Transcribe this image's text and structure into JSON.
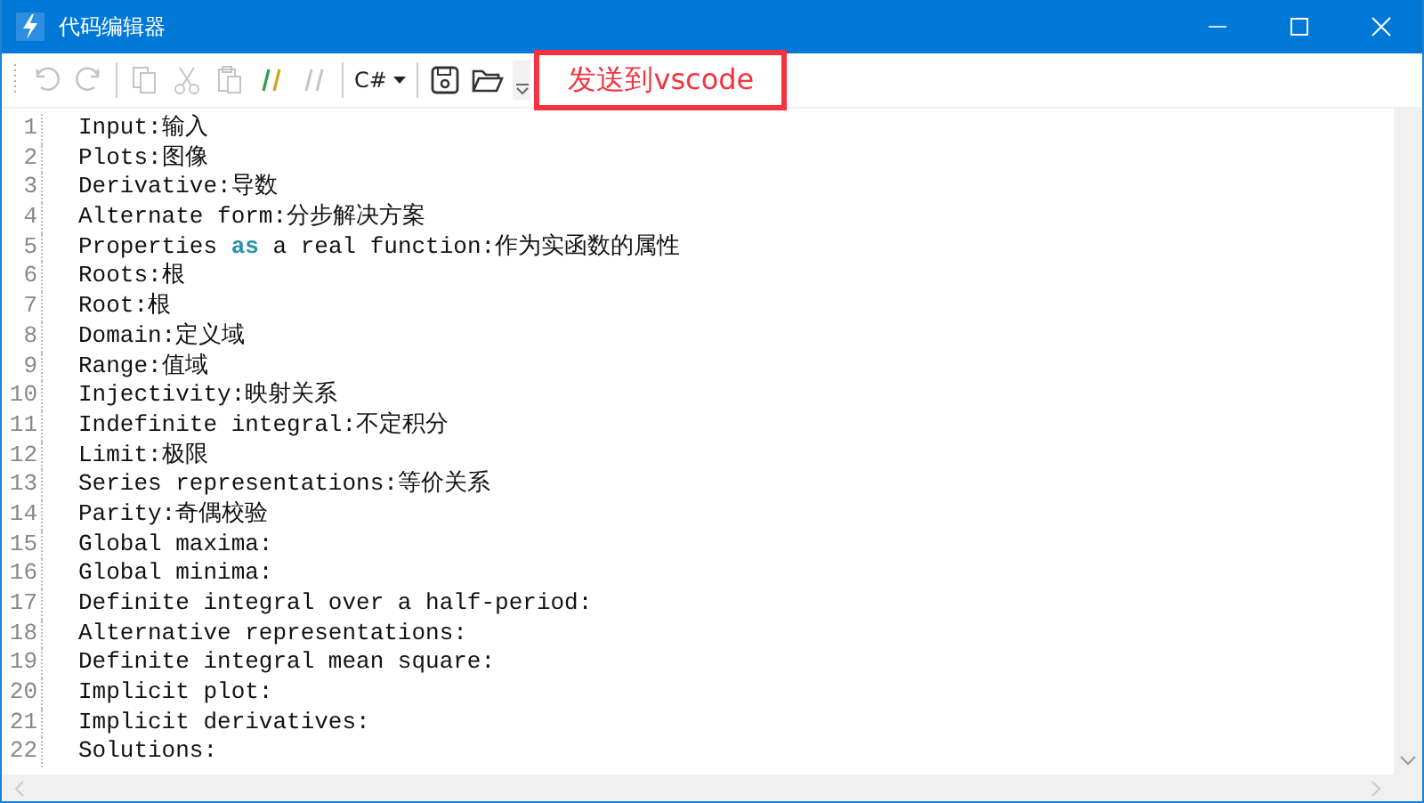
{
  "window": {
    "title": "代码编辑器"
  },
  "toolbar": {
    "tools": [
      {
        "kind": "undo",
        "disabled": true
      },
      {
        "kind": "redo",
        "disabled": true
      },
      {
        "kind": "separator"
      },
      {
        "kind": "copy",
        "disabled": true
      },
      {
        "kind": "cut",
        "disabled": true
      },
      {
        "kind": "paste",
        "disabled": true
      },
      {
        "kind": "comment",
        "disabled": false
      },
      {
        "kind": "uncomment",
        "disabled": true
      },
      {
        "kind": "separator"
      },
      {
        "kind": "language",
        "label": "C#"
      },
      {
        "kind": "separator"
      },
      {
        "kind": "save",
        "disabled": false
      },
      {
        "kind": "open",
        "disabled": false
      },
      {
        "kind": "overflow"
      }
    ],
    "send_button": {
      "label": "发送到vscode"
    }
  },
  "editor": {
    "lines": [
      {
        "number": "1",
        "segments": [
          {
            "kind": "plain",
            "text": "Input:输入"
          }
        ]
      },
      {
        "number": "2",
        "segments": [
          {
            "kind": "plain",
            "text": "Plots:图像"
          }
        ]
      },
      {
        "number": "3",
        "segments": [
          {
            "kind": "plain",
            "text": "Derivative:导数"
          }
        ]
      },
      {
        "number": "4",
        "segments": [
          {
            "kind": "plain",
            "text": "Alternate form:分步解决方案"
          }
        ]
      },
      {
        "number": "5",
        "segments": [
          {
            "kind": "plain",
            "text": "Properties "
          },
          {
            "kind": "keyword",
            "text": "as"
          },
          {
            "kind": "plain",
            "text": " a real function:作为实函数的属性"
          }
        ]
      },
      {
        "number": "6",
        "segments": [
          {
            "kind": "plain",
            "text": "Roots:根"
          }
        ]
      },
      {
        "number": "7",
        "segments": [
          {
            "kind": "plain",
            "text": "Root:根"
          }
        ]
      },
      {
        "number": "8",
        "segments": [
          {
            "kind": "plain",
            "text": "Domain:定义域"
          }
        ]
      },
      {
        "number": "9",
        "segments": [
          {
            "kind": "plain",
            "text": "Range:值域"
          }
        ]
      },
      {
        "number": "10",
        "segments": [
          {
            "kind": "plain",
            "text": "Injectivity:映射关系"
          }
        ]
      },
      {
        "number": "11",
        "segments": [
          {
            "kind": "plain",
            "text": "Indefinite integral:不定积分"
          }
        ]
      },
      {
        "number": "12",
        "segments": [
          {
            "kind": "plain",
            "text": "Limit:极限"
          }
        ]
      },
      {
        "number": "13",
        "segments": [
          {
            "kind": "plain",
            "text": "Series representations:等价关系"
          }
        ]
      },
      {
        "number": "14",
        "segments": [
          {
            "kind": "plain",
            "text": "Parity:奇偶校验"
          }
        ]
      },
      {
        "number": "15",
        "segments": [
          {
            "kind": "plain",
            "text": "Global maxima:"
          }
        ]
      },
      {
        "number": "16",
        "segments": [
          {
            "kind": "plain",
            "text": "Global minima:"
          }
        ]
      },
      {
        "number": "17",
        "segments": [
          {
            "kind": "plain",
            "text": "Definite integral over a half-period:"
          }
        ]
      },
      {
        "number": "18",
        "segments": [
          {
            "kind": "plain",
            "text": "Alternative representations:"
          }
        ]
      },
      {
        "number": "19",
        "segments": [
          {
            "kind": "plain",
            "text": "Definite integral mean square:"
          }
        ]
      },
      {
        "number": "20",
        "segments": [
          {
            "kind": "plain",
            "text": "Implicit plot:"
          }
        ]
      },
      {
        "number": "21",
        "segments": [
          {
            "kind": "plain",
            "text": "Implicit derivatives:"
          }
        ]
      },
      {
        "number": "22",
        "segments": [
          {
            "kind": "plain",
            "text": "Solutions:"
          }
        ]
      }
    ]
  }
}
